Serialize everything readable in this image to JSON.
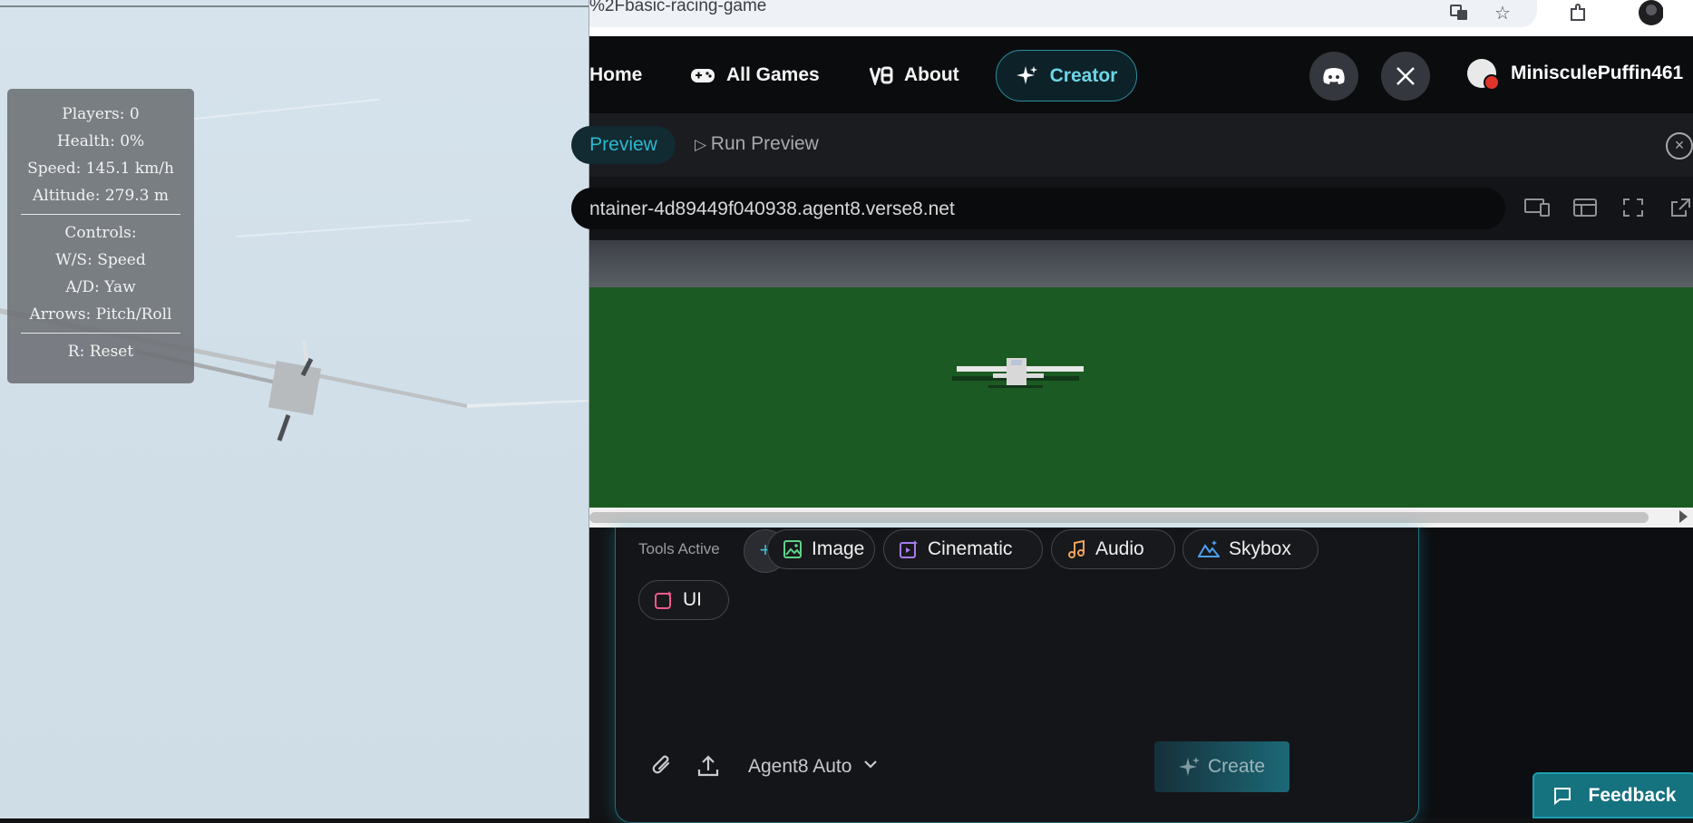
{
  "game": {
    "hud": {
      "players": "Players: 0",
      "health": "Health: 0%",
      "speed": "Speed: 145.1 km/h",
      "altitude": "Altitude: 279.3 m",
      "controls_title": "Controls:",
      "ws": "W/S: Speed",
      "ad": "A/D: Yaw",
      "arrows": "Arrows: Pitch/Roll",
      "reset": "R: Reset"
    }
  },
  "browser": {
    "url_fragment": "%2Fbasic-racing-game",
    "colors": {
      "accent": "#2bb9d0",
      "ground": "#1c5a23",
      "panel_border": "#1f6f7c"
    }
  },
  "nav": {
    "home": "Home",
    "all_games": "All Games",
    "about": "About",
    "creator": "Creator",
    "user": "MinisculePuffin461"
  },
  "tabs": {
    "preview": "Preview",
    "run_preview": "Run Preview"
  },
  "address": {
    "text": "ntainer-4d89449f040938.agent8.verse8.net"
  },
  "prompt": {
    "tools_label": "Tools Active",
    "chips": [
      "Image",
      "Cinematic",
      "Audio",
      "Skybox",
      "UI"
    ],
    "model": "Agent8 Auto",
    "create": "Create"
  },
  "feedback": "Feedback"
}
